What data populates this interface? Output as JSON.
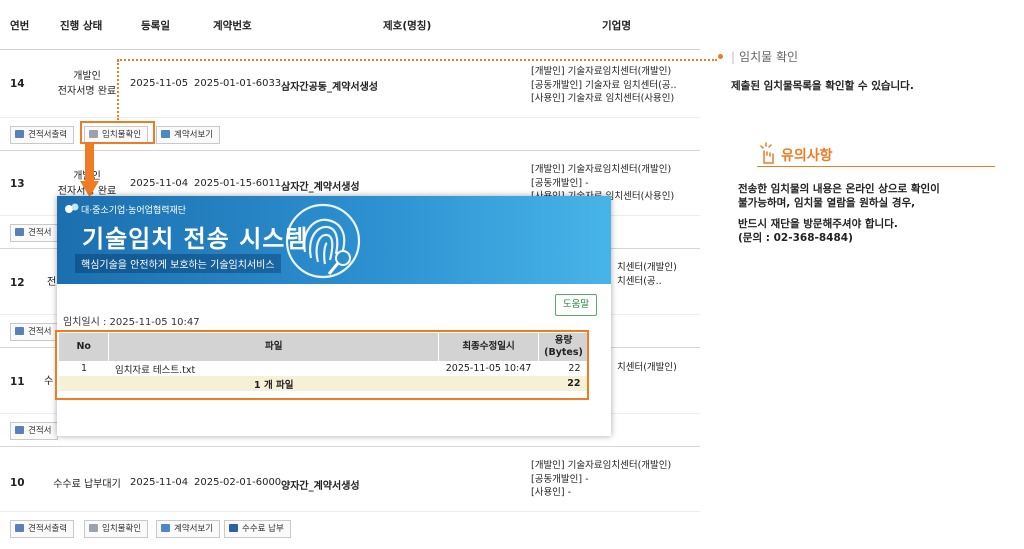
{
  "table": {
    "headers": [
      "연번",
      "진행 상태",
      "등록일",
      "계약번호",
      "제호(명칭)",
      "기업명"
    ],
    "rows": [
      {
        "no": "14",
        "status": [
          "개발인",
          "전자서명 완료"
        ],
        "date": "2025-11-05",
        "contract_no": "2025-01-01-6033",
        "title": "삼자간공동_계약서생성",
        "companies": [
          "[개발인] 기술자료임치센터(개발인)",
          "[공동개발인] 기술자료 임치센터(공..",
          "[사용인] 기술자료 임치센터(사용인)"
        ]
      },
      {
        "no": "13",
        "status": [
          "개발인",
          "전자서명 완료"
        ],
        "date": "2025-11-04",
        "contract_no": "2025-01-15-6011",
        "title": "삼자간_계약서생성",
        "companies": [
          "[개발인] 기술자료임치센터(개발인)",
          "[공동개발인] -",
          "[사용인] 기술자료 임치센터(사용인)"
        ]
      },
      {
        "no": "12",
        "status": [
          "",
          "전"
        ],
        "date": "",
        "contract_no": "",
        "title": "",
        "companies": [
          "치센터(개발인)",
          "치센터(공.."
        ]
      },
      {
        "no": "11",
        "status": [
          "수",
          ""
        ],
        "date": "",
        "contract_no": "",
        "title": "",
        "companies": [
          "치센터(개발인)"
        ]
      },
      {
        "no": "10",
        "status": [
          "수수료 납부대기",
          ""
        ],
        "date": "2025-11-04",
        "contract_no": "2025-02-01-6000",
        "title": "양자간_계약서생성",
        "companies": [
          "[개발인] 기술자료임치센터(개발인)",
          "[공동개발인] -",
          "[사용인] -"
        ]
      }
    ],
    "buttons": {
      "print": "견적서출력",
      "deposit_check": "임치물확인",
      "view_contract": "계약서보기",
      "pay_fee": "수수료 납부",
      "print_short": "견적서"
    }
  },
  "popup": {
    "org": "대·중소기업·농어업협력재단",
    "title": "기술임치 전송 시스템",
    "subtitle": "핵심기술을 안전하게 보호하는 기술임치서비스",
    "help": "도움말",
    "deposit_date": "임치일시 : 2025-11-05 10:47",
    "columns": {
      "no": "No",
      "file": "파일",
      "modified": "최종수정일시",
      "size": "용량\n(Bytes)"
    },
    "files": [
      {
        "no": "1",
        "name": "임치자료 테스트.txt",
        "modified": "2025-11-05 10:47",
        "size": "22"
      }
    ],
    "summary": {
      "count": "1 개 파일",
      "total": "22"
    }
  },
  "annotations": {
    "deposit_title": "임치물 확인",
    "deposit_desc": "제출된 임치물목록을 확인할 수 있습니다.",
    "caution_title": "유의사항",
    "caution_lines": [
      "전송한 임치물의 내용은 온라인 상으로 확인이",
      "불가능하며, 임치물 열람을 원하실 경우,",
      "반드시 재단을 방문해주셔야 합니다.",
      "(문의 : 02-368-8484)"
    ]
  },
  "colors": {
    "accent": "#ef7b22",
    "banner": "#2c8fd0",
    "help": "#2d8a3e"
  }
}
